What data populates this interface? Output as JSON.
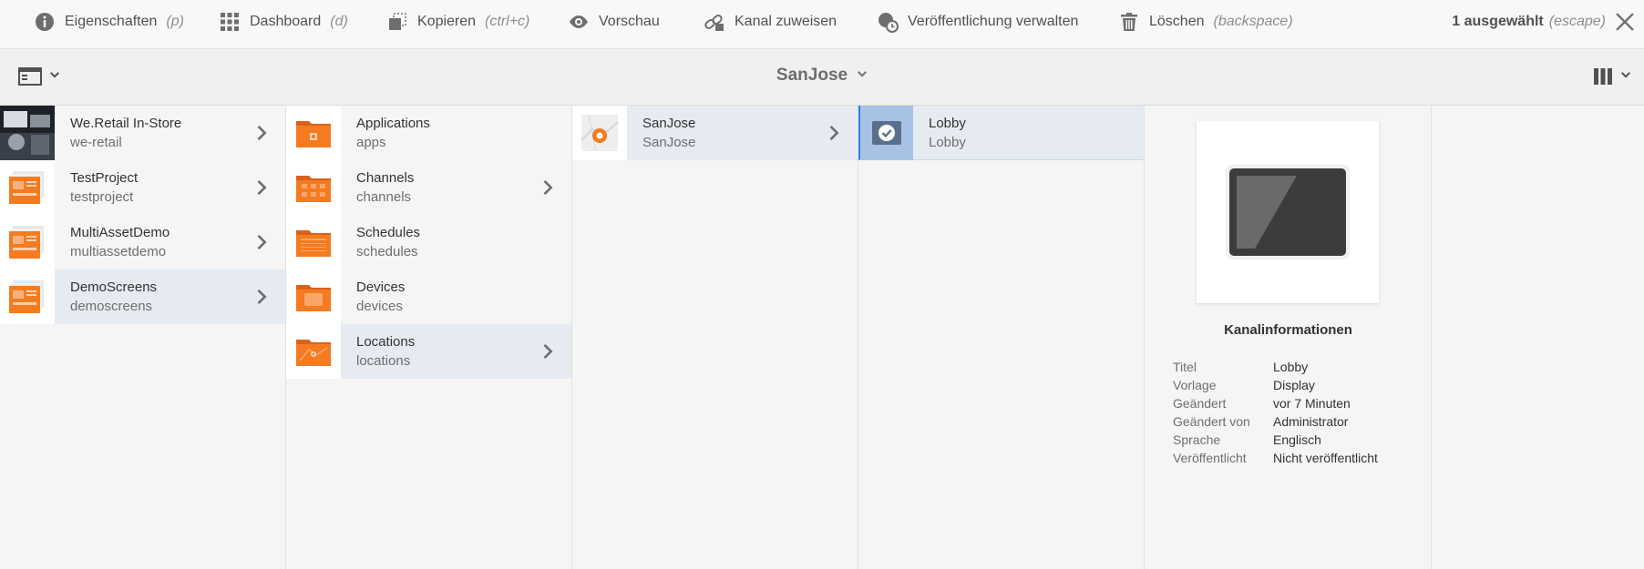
{
  "actionbar": {
    "buttons": [
      {
        "icon": "info-icon",
        "label": "Eigenschaften",
        "shortcut": "(p)"
      },
      {
        "icon": "grid-icon",
        "label": "Dashboard",
        "shortcut": "(d)"
      },
      {
        "icon": "copy-icon",
        "label": "Kopieren",
        "shortcut": "(ctrl+c)"
      },
      {
        "icon": "eye-icon",
        "label": "Vorschau",
        "shortcut": ""
      },
      {
        "icon": "link-icon",
        "label": "Kanal zuweisen",
        "shortcut": ""
      },
      {
        "icon": "globe-clock-icon",
        "label": "Veröffentlichung verwalten",
        "shortcut": ""
      },
      {
        "icon": "trash-icon",
        "label": "Löschen",
        "shortcut": "(backspace)"
      }
    ],
    "selection_count": "1 ausgewählt",
    "selection_shortcut": "(escape)"
  },
  "titlebar": {
    "breadcrumb": "SanJose"
  },
  "columns": {
    "projects": [
      {
        "name": "We.Retail In-Store",
        "path": "we-retail",
        "active": false
      },
      {
        "name": "TestProject",
        "path": "testproject",
        "active": false
      },
      {
        "name": "MultiAssetDemo",
        "path": "multiassetdemo",
        "active": false
      },
      {
        "name": "DemoScreens",
        "path": "demoscreens",
        "active": true
      }
    ],
    "folders": [
      {
        "name": "Applications",
        "path": "apps"
      },
      {
        "name": "Channels",
        "path": "channels"
      },
      {
        "name": "Schedules",
        "path": "schedules"
      },
      {
        "name": "Devices",
        "path": "devices"
      },
      {
        "name": "Locations",
        "path": "locations"
      }
    ],
    "locations": [
      {
        "name": "SanJose",
        "path": "SanJose"
      }
    ],
    "channels": [
      {
        "name": "Lobby",
        "path": "Lobby"
      }
    ]
  },
  "preview": {
    "title": "Kanalinformationen",
    "fields": [
      {
        "key": "Titel",
        "value": "Lobby"
      },
      {
        "key": "Vorlage",
        "value": "Display"
      },
      {
        "key": "Geändert",
        "value": "vor 7 Minuten"
      },
      {
        "key": "Geändert von",
        "value": "Administrator"
      },
      {
        "key": "Sprache",
        "value": "Englisch"
      },
      {
        "key": "Veröffentlicht",
        "value": "Nicht veröffentlicht"
      }
    ]
  },
  "colors": {
    "accent": "#2680eb",
    "folder_orange": "#f47b20",
    "selection_bg": "#e6ebf2"
  }
}
